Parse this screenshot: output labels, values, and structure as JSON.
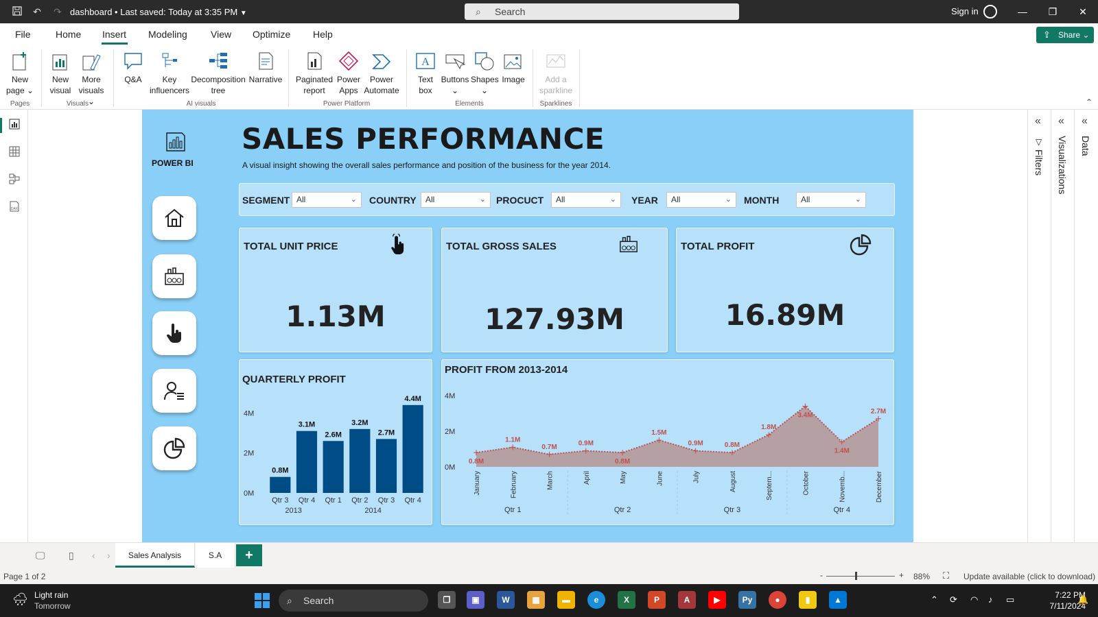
{
  "titlebar": {
    "doc_title": "dashboard • Last saved: Today at 3:35 PM",
    "search_placeholder": "Search",
    "signin": "Sign in"
  },
  "ribbon_tabs": [
    "File",
    "Home",
    "Insert",
    "Modeling",
    "View",
    "Optimize",
    "Help"
  ],
  "active_tab": "Insert",
  "share_label": "Share",
  "ribbon": {
    "pages": {
      "new_page": "New page",
      "group": "Pages"
    },
    "visuals": {
      "new_visual": "New visual",
      "more_visuals": "More visuals",
      "group": "Visuals"
    },
    "ai": {
      "qa": "Q&A",
      "key_influencers": "Key influencers",
      "decomp": "Decomposition tree",
      "narrative": "Narrative",
      "group": "AI visuals"
    },
    "platform": {
      "paginated": "Paginated report",
      "power_apps": "Power Apps",
      "power_automate": "Power Automate",
      "group": "Power Platform"
    },
    "elements": {
      "text_box": "Text box",
      "buttons": "Buttons",
      "shapes": "Shapes",
      "image": "Image",
      "group": "Elements"
    },
    "sparklines": {
      "add": "Add a sparkline",
      "group": "Sparklines"
    }
  },
  "right_panes": {
    "filters": "Filters",
    "visualizations": "Visualizations",
    "data": "Data"
  },
  "report": {
    "logo_text": "POWER BI",
    "title": "SALES PERFORMANCE",
    "subtitle": "A visual insight showing the overall sales performance and position of the business for the year 2014.",
    "filters": [
      {
        "label": "SEGMENT",
        "value": "All"
      },
      {
        "label": "COUNTRY",
        "value": "All"
      },
      {
        "label": "PROCUCT",
        "value": "All"
      },
      {
        "label": "YEAR",
        "value": "All"
      },
      {
        "label": "MONTH",
        "value": "All"
      }
    ],
    "kpis": [
      {
        "title": "TOTAL UNIT PRICE",
        "value": "1.13M",
        "icon": "hand-pointer-icon"
      },
      {
        "title": "TOTAL GROSS SALES",
        "value": "127.93M",
        "icon": "factory-icon"
      },
      {
        "title": "TOTAL PROFIT",
        "value": "16.89M",
        "icon": "pie-chart-icon"
      }
    ],
    "nav_icons": [
      "home-icon",
      "factory-icon",
      "hand-pointer-icon",
      "person-list-icon",
      "pie-chart-icon"
    ]
  },
  "chart_data": [
    {
      "type": "bar",
      "title": "QUARTERLY PROFIT",
      "categories": [
        "Qtr 3",
        "Qtr 4",
        "Qtr 1",
        "Qtr 2",
        "Qtr 3",
        "Qtr 4"
      ],
      "groups": [
        {
          "label": "2013",
          "count": 2
        },
        {
          "label": "2014",
          "count": 4
        }
      ],
      "values": [
        0.8,
        3.1,
        2.6,
        3.2,
        2.7,
        4.4
      ],
      "labels": [
        "0.8M",
        "3.1M",
        "2.6M",
        "3.2M",
        "2.7M",
        "4.4M"
      ],
      "yticks": [
        "0M",
        "2M",
        "4M"
      ],
      "ylim": [
        0,
        4.6
      ],
      "color": "#004c87"
    },
    {
      "type": "area",
      "title": "PROFIT FROM 2013-2014",
      "categories": [
        "January",
        "February",
        "March",
        "April",
        "May",
        "June",
        "July",
        "August",
        "Septem...",
        "October",
        "Novemb...",
        "December"
      ],
      "quarters": [
        "Qtr 1",
        "Qtr 2",
        "Qtr 3",
        "Qtr 4"
      ],
      "values": [
        0.8,
        1.1,
        0.7,
        0.9,
        0.8,
        1.5,
        0.9,
        0.8,
        1.8,
        3.4,
        1.4,
        2.7
      ],
      "labels": [
        "0.8M",
        "1.1M",
        "0.7M",
        "0.9M",
        "0.8M",
        "1.5M",
        "0.9M",
        "0.8M",
        "1.8M",
        "3.4M",
        "1.4M",
        "2.7M"
      ],
      "yticks": [
        "0M",
        "2M",
        "4M"
      ],
      "ylim": [
        0,
        4
      ],
      "line_color": "#c0504d",
      "fill_color": "#b59a9a"
    }
  ],
  "page_tabs": [
    "Sales Analysis",
    "S.A"
  ],
  "status": {
    "page_info": "Page 1 of 2",
    "zoom": "88%",
    "update": "Update available (click to download)"
  },
  "taskbar": {
    "weather_title": "Light rain",
    "weather_sub": "Tomorrow",
    "search": "Search",
    "time": "7:22 PM",
    "date": "7/11/2024"
  }
}
